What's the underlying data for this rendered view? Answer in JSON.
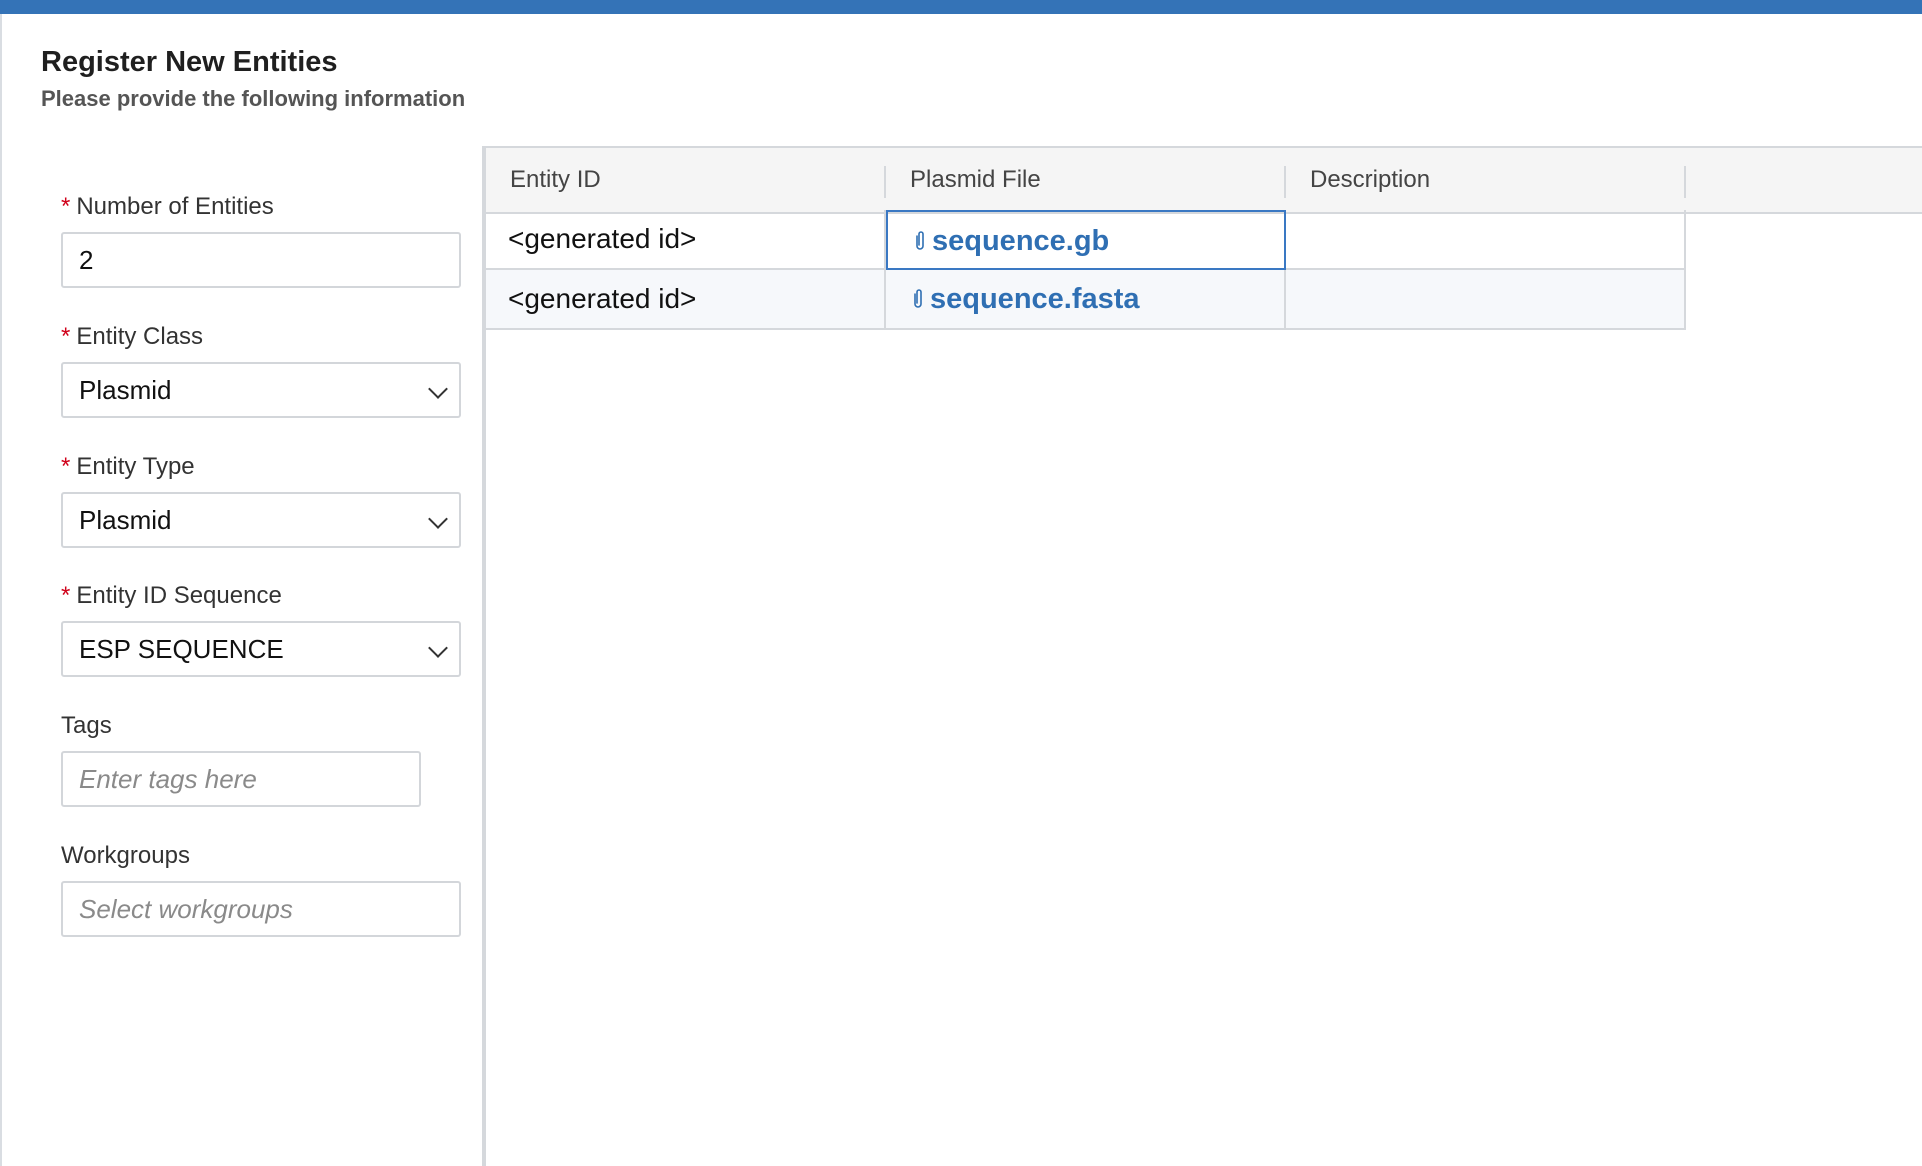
{
  "header": {
    "title": "Register New Entities",
    "subtitle": "Please provide the following information"
  },
  "form": {
    "number_of_entities": {
      "label": "Number of Entities",
      "required": true,
      "value": "2"
    },
    "entity_class": {
      "label": "Entity Class",
      "required": true,
      "value": "Plasmid"
    },
    "entity_type": {
      "label": "Entity Type",
      "required": true,
      "value": "Plasmid"
    },
    "entity_id_sequence": {
      "label": "Entity ID Sequence",
      "required": true,
      "value": "ESP SEQUENCE"
    },
    "tags": {
      "label": "Tags",
      "placeholder": "Enter tags here"
    },
    "workgroups": {
      "label": "Workgroups",
      "placeholder": "Select workgroups"
    }
  },
  "grid": {
    "columns": [
      "Entity ID",
      "Plasmid File",
      "Description"
    ],
    "rows": [
      {
        "entity_id": "<generated id>",
        "plasmid_file": "sequence.gb",
        "description": "",
        "selected_col": "plasmid_file"
      },
      {
        "entity_id": "<generated id>",
        "plasmid_file": "sequence.fasta",
        "description": ""
      }
    ]
  },
  "icons": {
    "file": "paperclip-icon",
    "dropdown": "chevron-down-icon"
  },
  "colors": {
    "accent": "#3473b7",
    "link": "#2f6fb3",
    "required": "#d0021b"
  }
}
